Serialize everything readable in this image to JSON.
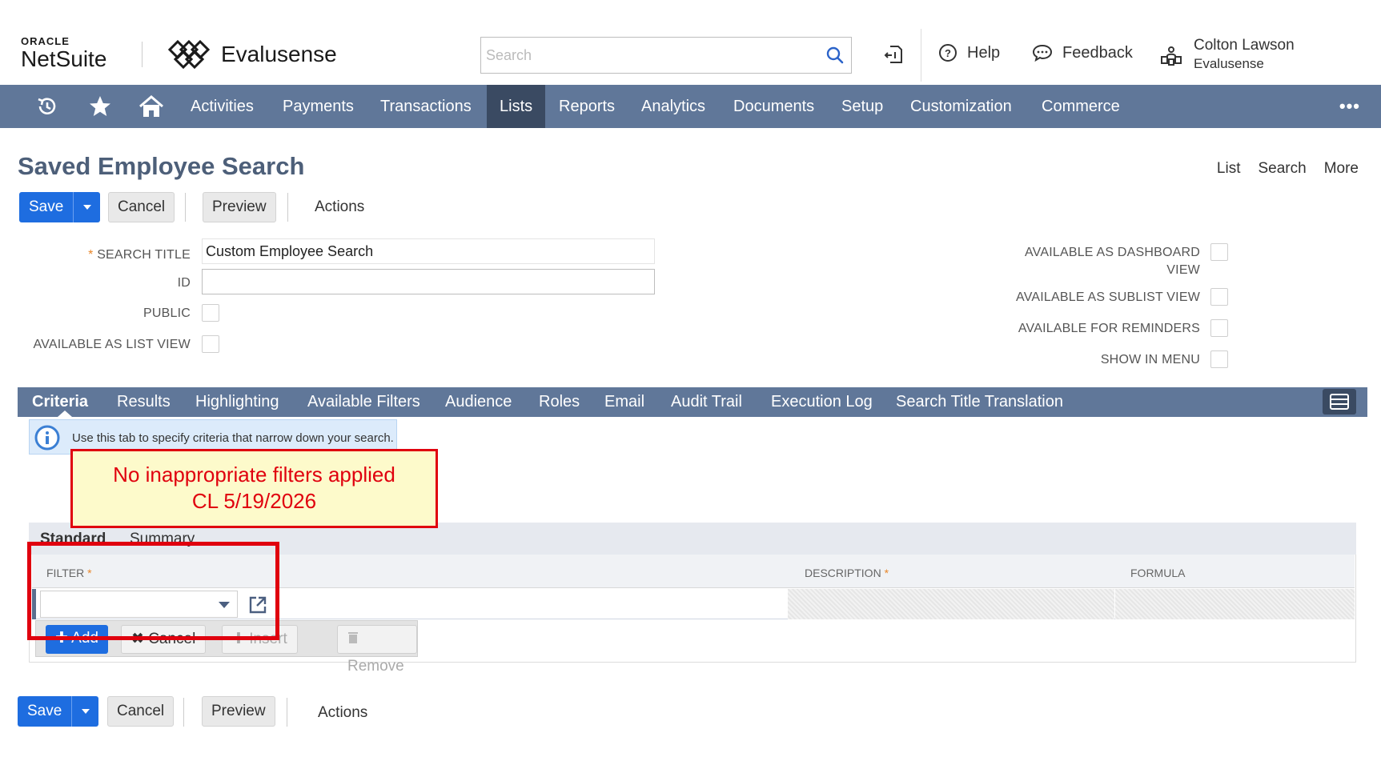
{
  "header": {
    "oracle_label": "ORACLE",
    "netsuite_label": "NetSuite",
    "company_name": "Evalusense",
    "search_placeholder": "Search",
    "help_label": "Help",
    "feedback_label": "Feedback",
    "user_name": "Colton Lawson",
    "user_company": "Evalusense"
  },
  "nav": {
    "items": [
      "Activities",
      "Payments",
      "Transactions",
      "Lists",
      "Reports",
      "Analytics",
      "Documents",
      "Setup",
      "Customization",
      "Commerce"
    ],
    "active": "Lists",
    "more_label": "•••"
  },
  "page": {
    "title": "Saved Employee Search",
    "links": [
      "List",
      "Search",
      "More"
    ]
  },
  "toolbar": {
    "save_label": "Save",
    "cancel_label": "Cancel",
    "preview_label": "Preview",
    "actions_label": "Actions"
  },
  "form": {
    "search_title_label": "SEARCH TITLE",
    "search_title_value": "Custom Employee Search",
    "id_label": "ID",
    "id_value": "",
    "public_label": "PUBLIC",
    "list_view_label": "AVAILABLE AS LIST VIEW",
    "dashboard_label_1": "AVAILABLE AS DASHBOARD",
    "dashboard_label_2": "VIEW",
    "sublist_view_label": "AVAILABLE AS SUBLIST VIEW",
    "reminders_label": "AVAILABLE FOR REMINDERS",
    "show_menu_label": "SHOW IN MENU"
  },
  "tabs": {
    "items": [
      "Criteria",
      "Results",
      "Highlighting",
      "Available Filters",
      "Audience",
      "Roles",
      "Email",
      "Audit Trail",
      "Execution Log",
      "Search Title Translation"
    ],
    "active": "Criteria"
  },
  "info": {
    "text": "Use this tab to specify criteria that narrow down your search."
  },
  "annotation": {
    "line1": "No inappropriate filters applied",
    "line2": "CL 5/19/2026",
    "color": "#e0000e"
  },
  "sublist": {
    "subtabs": [
      "Standard",
      "Summary"
    ],
    "columns": {
      "filter": "FILTER",
      "description": "DESCRIPTION",
      "formula": "FORMULA"
    },
    "buttons": {
      "add": "Add",
      "cancel": "Cancel",
      "insert": "Insert",
      "remove": "Remove"
    }
  },
  "colors": {
    "nav_bg": "#607799",
    "nav_active": "#3a4a62",
    "primary": "#1e6de0",
    "title": "#4d5f79"
  }
}
